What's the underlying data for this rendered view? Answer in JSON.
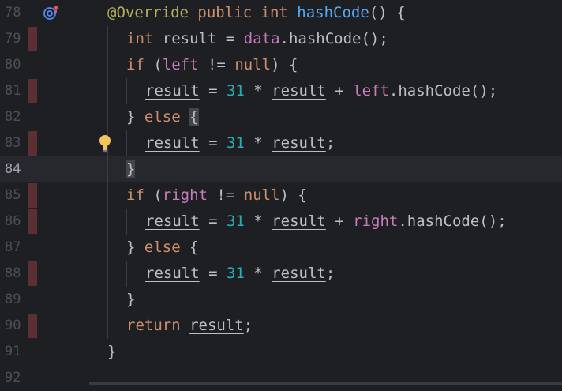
{
  "editor": {
    "current_line": 84,
    "gutter_icons": {
      "override": "override-method-icon",
      "bulb": "lightbulb-icon"
    },
    "colors": {
      "background": "#1e1f22",
      "keyword": "#cf8e6d",
      "annotation": "#b3ae60",
      "method": "#56a8f5",
      "field": "#c77dbb",
      "number": "#2aacb8",
      "text": "#bcbec4",
      "change_marker": "#5c2f33"
    },
    "lines": [
      {
        "num": "78",
        "changed": false,
        "tokens": [
          {
            "t": "@Override",
            "c": "ann"
          },
          {
            "t": " "
          },
          {
            "t": "public",
            "c": "kw"
          },
          {
            "t": " "
          },
          {
            "t": "int",
            "c": "kw"
          },
          {
            "t": " "
          },
          {
            "t": "hashCode",
            "c": "fn"
          },
          {
            "t": "() {"
          }
        ]
      },
      {
        "num": "79",
        "changed": true,
        "tokens": [
          {
            "t": "int",
            "c": "kw"
          },
          {
            "t": " "
          },
          {
            "t": "result",
            "c": "lv"
          },
          {
            "t": " = "
          },
          {
            "t": "data",
            "c": "fld"
          },
          {
            "t": ".hashCode();"
          }
        ]
      },
      {
        "num": "80",
        "changed": false,
        "tokens": [
          {
            "t": "if",
            "c": "kw"
          },
          {
            "t": " ("
          },
          {
            "t": "left",
            "c": "fld"
          },
          {
            "t": " != "
          },
          {
            "t": "null",
            "c": "kw"
          },
          {
            "t": ") {"
          }
        ]
      },
      {
        "num": "81",
        "changed": true,
        "tokens": [
          {
            "t": "result",
            "c": "lv"
          },
          {
            "t": " = "
          },
          {
            "t": "31",
            "c": "num"
          },
          {
            "t": " * "
          },
          {
            "t": "result",
            "c": "lv"
          },
          {
            "t": " + "
          },
          {
            "t": "left",
            "c": "fld"
          },
          {
            "t": ".hashCode();"
          }
        ]
      },
      {
        "num": "82",
        "changed": false,
        "tokens": [
          {
            "t": "} "
          },
          {
            "t": "else",
            "c": "kw"
          },
          {
            "t": " "
          },
          {
            "t": "{",
            "c": "brace"
          }
        ]
      },
      {
        "num": "83",
        "changed": true,
        "tokens": [
          {
            "t": "result",
            "c": "lv"
          },
          {
            "t": " = "
          },
          {
            "t": "31",
            "c": "num"
          },
          {
            "t": " * "
          },
          {
            "t": "result",
            "c": "lv"
          },
          {
            "t": ";"
          }
        ]
      },
      {
        "num": "84",
        "changed": false,
        "tokens": [
          {
            "t": "}",
            "c": "brace"
          }
        ]
      },
      {
        "num": "85",
        "changed": true,
        "tokens": [
          {
            "t": "if",
            "c": "kw"
          },
          {
            "t": " ("
          },
          {
            "t": "right",
            "c": "fld"
          },
          {
            "t": " != "
          },
          {
            "t": "null",
            "c": "kw"
          },
          {
            "t": ") {"
          }
        ]
      },
      {
        "num": "86",
        "changed": true,
        "tokens": [
          {
            "t": "result",
            "c": "lv"
          },
          {
            "t": " = "
          },
          {
            "t": "31",
            "c": "num"
          },
          {
            "t": " * "
          },
          {
            "t": "result",
            "c": "lv"
          },
          {
            "t": " + "
          },
          {
            "t": "right",
            "c": "fld"
          },
          {
            "t": ".hashCode();"
          }
        ]
      },
      {
        "num": "87",
        "changed": false,
        "tokens": [
          {
            "t": "} "
          },
          {
            "t": "else",
            "c": "kw"
          },
          {
            "t": " {"
          }
        ]
      },
      {
        "num": "88",
        "changed": true,
        "tokens": [
          {
            "t": "result",
            "c": "lv"
          },
          {
            "t": " = "
          },
          {
            "t": "31",
            "c": "num"
          },
          {
            "t": " * "
          },
          {
            "t": "result",
            "c": "lv"
          },
          {
            "t": ";"
          }
        ]
      },
      {
        "num": "89",
        "changed": false,
        "tokens": [
          {
            "t": "}"
          }
        ]
      },
      {
        "num": "90",
        "changed": true,
        "tokens": [
          {
            "t": "return",
            "c": "kw"
          },
          {
            "t": " "
          },
          {
            "t": "result",
            "c": "lv"
          },
          {
            "t": ";"
          }
        ]
      },
      {
        "num": "91",
        "changed": false,
        "tokens": [
          {
            "t": "}"
          }
        ]
      },
      {
        "num": "92",
        "changed": false,
        "tokens": []
      }
    ]
  }
}
